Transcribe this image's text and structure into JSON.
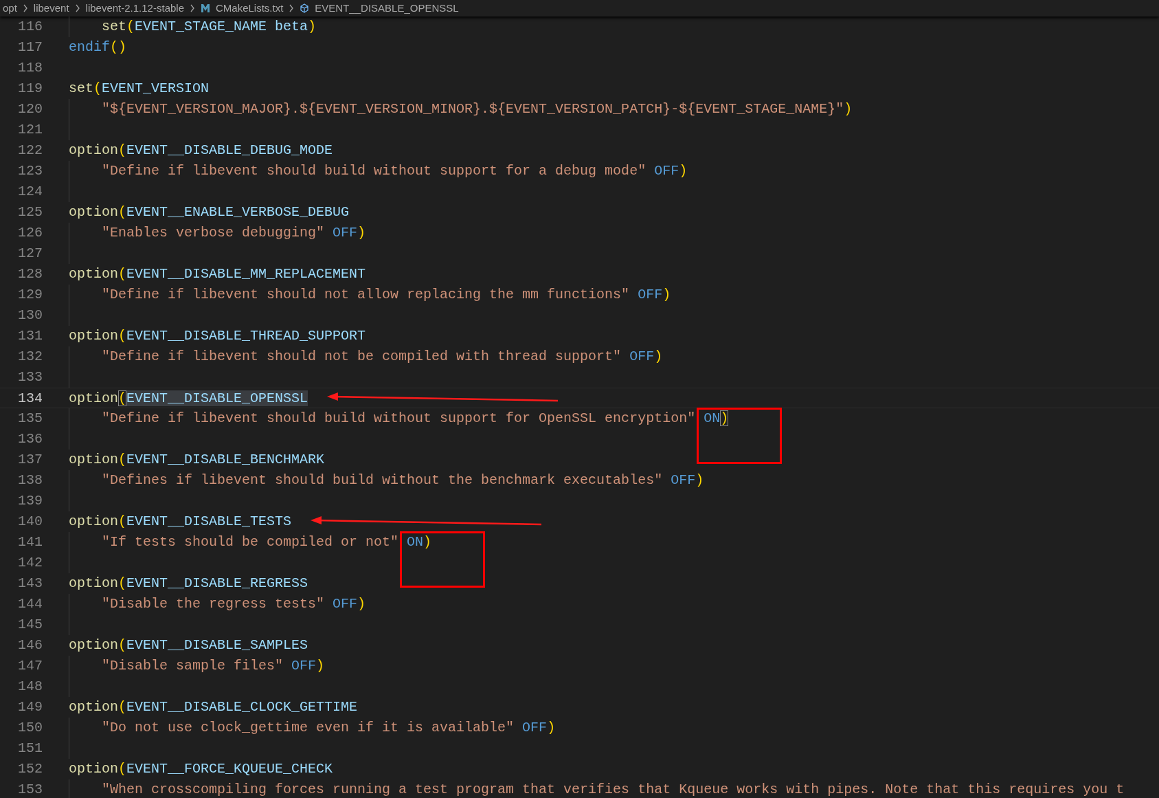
{
  "breadcrumb": [
    {
      "label": "opt",
      "kind": "folder"
    },
    {
      "label": "libevent",
      "kind": "folder"
    },
    {
      "label": "libevent-2.1.12-stable",
      "kind": "folder"
    },
    {
      "label": "CMakeLists.txt",
      "kind": "file"
    },
    {
      "label": "EVENT__DISABLE_OPENSSL",
      "kind": "symbol"
    }
  ],
  "lines": [
    {
      "number": "116",
      "indented": true,
      "current": false,
      "tokens": [
        {
          "kind": "func",
          "text": "set"
        },
        {
          "kind": "paren",
          "text": "("
        },
        {
          "kind": "var",
          "text": "EVENT_STAGE_NAME beta"
        },
        {
          "kind": "paren",
          "text": ")"
        }
      ]
    },
    {
      "number": "117",
      "indented": false,
      "current": false,
      "tokens": [
        {
          "kind": "keyword",
          "text": "endif"
        },
        {
          "kind": "paren",
          "text": "()"
        }
      ]
    },
    {
      "number": "118",
      "indented": false,
      "current": false
    },
    {
      "number": "119",
      "indented": false,
      "current": false,
      "tokens": [
        {
          "kind": "func",
          "text": "set"
        },
        {
          "kind": "paren",
          "text": "("
        },
        {
          "kind": "var",
          "text": "EVENT_VERSION"
        }
      ]
    },
    {
      "number": "120",
      "indented": true,
      "current": false,
      "tokens": [
        {
          "kind": "str",
          "text": "\"${EVENT_VERSION_MAJOR}.${EVENT_VERSION_MINOR}.${EVENT_VERSION_PATCH}-${EVENT_STAGE_NAME}\""
        },
        {
          "kind": "paren",
          "text": ")"
        }
      ]
    },
    {
      "number": "121",
      "indented": true,
      "current": false
    },
    {
      "number": "122",
      "indented": false,
      "current": false,
      "tokens": [
        {
          "kind": "func",
          "text": "option"
        },
        {
          "kind": "paren",
          "text": "("
        },
        {
          "kind": "var",
          "text": "EVENT__DISABLE_DEBUG_MODE"
        }
      ]
    },
    {
      "number": "123",
      "indented": true,
      "current": false,
      "tokens": [
        {
          "kind": "str",
          "text": "\"Define if libevent should build without support for a debug mode\""
        },
        {
          "kind": "const",
          "text": "OFF"
        },
        {
          "kind": "paren",
          "text": ")"
        }
      ]
    },
    {
      "number": "124",
      "indented": true,
      "current": false
    },
    {
      "number": "125",
      "indented": false,
      "current": false,
      "tokens": [
        {
          "kind": "func",
          "text": "option"
        },
        {
          "kind": "paren",
          "text": "("
        },
        {
          "kind": "var",
          "text": "EVENT__ENABLE_VERBOSE_DEBUG"
        }
      ]
    },
    {
      "number": "126",
      "indented": true,
      "current": false,
      "tokens": [
        {
          "kind": "str",
          "text": "\"Enables verbose debugging\""
        },
        {
          "kind": "const",
          "text": "OFF"
        },
        {
          "kind": "paren",
          "text": ")"
        }
      ]
    },
    {
      "number": "127",
      "indented": true,
      "current": false
    },
    {
      "number": "128",
      "indented": false,
      "current": false,
      "tokens": [
        {
          "kind": "func",
          "text": "option"
        },
        {
          "kind": "paren",
          "text": "("
        },
        {
          "kind": "var",
          "text": "EVENT__DISABLE_MM_REPLACEMENT"
        }
      ]
    },
    {
      "number": "129",
      "indented": true,
      "current": false,
      "tokens": [
        {
          "kind": "str",
          "text": "\"Define if libevent should not allow replacing the mm functions\""
        },
        {
          "kind": "const",
          "text": "OFF"
        },
        {
          "kind": "paren",
          "text": ")"
        }
      ]
    },
    {
      "number": "130",
      "indented": true,
      "current": false
    },
    {
      "number": "131",
      "indented": false,
      "current": false,
      "tokens": [
        {
          "kind": "func",
          "text": "option"
        },
        {
          "kind": "paren",
          "text": "("
        },
        {
          "kind": "var",
          "text": "EVENT__DISABLE_THREAD_SUPPORT"
        }
      ]
    },
    {
      "number": "132",
      "indented": true,
      "current": false,
      "tokens": [
        {
          "kind": "str",
          "text": "\"Define if libevent should not be compiled with thread support\""
        },
        {
          "kind": "const",
          "text": "OFF"
        },
        {
          "kind": "paren",
          "text": ")"
        }
      ]
    },
    {
      "number": "133",
      "indented": true,
      "current": false
    },
    {
      "number": "134",
      "indented": false,
      "current": true,
      "arrow": true,
      "tokens": [
        {
          "kind": "func",
          "text": "option"
        },
        {
          "kind": "paren",
          "text": "(",
          "bracket_match": true
        },
        {
          "kind": "var",
          "text": "EVENT__DISABLE_OPENSSL",
          "selected": true
        }
      ]
    },
    {
      "number": "135",
      "indented": true,
      "current": false,
      "tokens": [
        {
          "kind": "str",
          "text": "\"Define if libevent should build without support for OpenSSL encryption\""
        },
        {
          "kind": "const",
          "text": "ON",
          "boxed": true
        },
        {
          "kind": "paren",
          "text": ")",
          "bracket_match": true
        }
      ]
    },
    {
      "number": "136",
      "indented": true,
      "current": false
    },
    {
      "number": "137",
      "indented": false,
      "current": false,
      "tokens": [
        {
          "kind": "func",
          "text": "option"
        },
        {
          "kind": "paren",
          "text": "("
        },
        {
          "kind": "var",
          "text": "EVENT__DISABLE_BENCHMARK"
        }
      ]
    },
    {
      "number": "138",
      "indented": true,
      "current": false,
      "tokens": [
        {
          "kind": "str",
          "text": "\"Defines if libevent should build without the benchmark executables\""
        },
        {
          "kind": "const",
          "text": "OFF"
        },
        {
          "kind": "paren",
          "text": ")"
        }
      ]
    },
    {
      "number": "139",
      "indented": true,
      "current": false
    },
    {
      "number": "140",
      "indented": false,
      "current": false,
      "arrow": true,
      "tokens": [
        {
          "kind": "func",
          "text": "option"
        },
        {
          "kind": "paren",
          "text": "("
        },
        {
          "kind": "var",
          "text": "EVENT__DISABLE_TESTS"
        }
      ]
    },
    {
      "number": "141",
      "indented": true,
      "current": false,
      "tokens": [
        {
          "kind": "str",
          "text": "\"If tests should be compiled or not\""
        },
        {
          "kind": "const",
          "text": "ON",
          "boxed": true
        },
        {
          "kind": "paren",
          "text": ")"
        }
      ]
    },
    {
      "number": "142",
      "indented": true,
      "current": false
    },
    {
      "number": "143",
      "indented": false,
      "current": false,
      "tokens": [
        {
          "kind": "func",
          "text": "option"
        },
        {
          "kind": "paren",
          "text": "("
        },
        {
          "kind": "var",
          "text": "EVENT__DISABLE_REGRESS"
        }
      ]
    },
    {
      "number": "144",
      "indented": true,
      "current": false,
      "tokens": [
        {
          "kind": "str",
          "text": "\"Disable the regress tests\""
        },
        {
          "kind": "const",
          "text": "OFF"
        },
        {
          "kind": "paren",
          "text": ")"
        }
      ]
    },
    {
      "number": "145",
      "indented": true,
      "current": false
    },
    {
      "number": "146",
      "indented": false,
      "current": false,
      "tokens": [
        {
          "kind": "func",
          "text": "option"
        },
        {
          "kind": "paren",
          "text": "("
        },
        {
          "kind": "var",
          "text": "EVENT__DISABLE_SAMPLES"
        }
      ]
    },
    {
      "number": "147",
      "indented": true,
      "current": false,
      "tokens": [
        {
          "kind": "str",
          "text": "\"Disable sample files\""
        },
        {
          "kind": "const",
          "text": "OFF"
        },
        {
          "kind": "paren",
          "text": ")"
        }
      ]
    },
    {
      "number": "148",
      "indented": true,
      "current": false
    },
    {
      "number": "149",
      "indented": false,
      "current": false,
      "tokens": [
        {
          "kind": "func",
          "text": "option"
        },
        {
          "kind": "paren",
          "text": "("
        },
        {
          "kind": "var",
          "text": "EVENT__DISABLE_CLOCK_GETTIME"
        }
      ]
    },
    {
      "number": "150",
      "indented": true,
      "current": false,
      "tokens": [
        {
          "kind": "str",
          "text": "\"Do not use clock_gettime even if it is available\""
        },
        {
          "kind": "const",
          "text": "OFF"
        },
        {
          "kind": "paren",
          "text": ")"
        }
      ]
    },
    {
      "number": "151",
      "indented": true,
      "current": false
    },
    {
      "number": "152",
      "indented": false,
      "current": false,
      "tokens": [
        {
          "kind": "func",
          "text": "option"
        },
        {
          "kind": "paren",
          "text": "("
        },
        {
          "kind": "var",
          "text": "EVENT__FORCE_KQUEUE_CHECK"
        }
      ]
    },
    {
      "number": "153",
      "indented": true,
      "current": false,
      "tokens": [
        {
          "kind": "str",
          "text": "\"When crosscompiling forces running a test program that verifies that Kqueue works with pipes. Note that this requires you t"
        }
      ]
    }
  ]
}
